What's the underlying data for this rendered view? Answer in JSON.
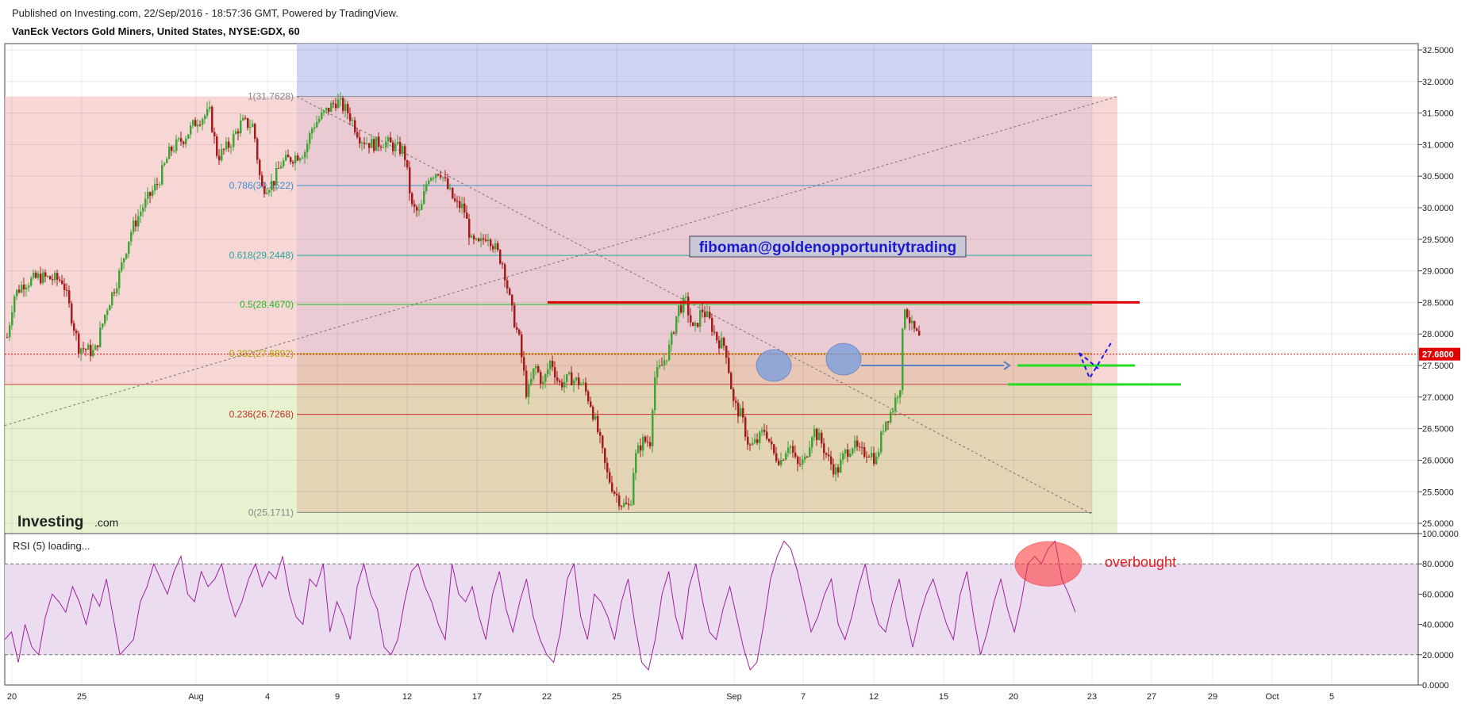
{
  "header": {
    "published": "Published on Investing.com, 22/Sep/2016 - 18:57:36 GMT, Powered by TradingView.",
    "instrument": "VanEck Vectors Gold Miners, United States, NYSE:GDX, 60"
  },
  "colors": {
    "up": "#3fa535",
    "down": "#a51a1a",
    "blue_zone": "#c8cdf2",
    "red_zone": "#f4c8c8",
    "green_zone": "#e2f0c8",
    "resistance": "#dd0000",
    "support": "#22dd22",
    "rsi": "#a020a0",
    "rsi_band": "#ecdcef"
  },
  "chart_data": [
    {
      "type": "candlestick",
      "title": "VanEck Vectors Gold Miners, United States, NYSE:GDX, 60",
      "ylim": [
        24.85,
        32.6
      ],
      "y_ticks": [
        "32.5000",
        "32.0000",
        "31.5000",
        "31.0000",
        "30.5000",
        "30.0000",
        "29.5000",
        "29.0000",
        "28.5000",
        "28.0000",
        "27.5000",
        "27.0000",
        "26.5000",
        "26.0000",
        "25.5000",
        "25.0000"
      ],
      "x_tick_labels": [
        "20",
        "25",
        "Aug",
        "4",
        "9",
        "12",
        "17",
        "22",
        "25",
        "Sep",
        "7",
        "12",
        "15",
        "20",
        "23",
        "27",
        "29",
        "Oct",
        "5"
      ],
      "last_price": "27.6800",
      "fib_levels": [
        {
          "label": "1(31.7628)",
          "value": 31.7628,
          "color": "#888888"
        },
        {
          "label": "0.786(30.3522)",
          "value": 30.3522,
          "color": "#3a8fd0"
        },
        {
          "label": "0.618(29.2448)",
          "value": 29.2448,
          "color": "#22a99a"
        },
        {
          "label": "0.5(28.4670)",
          "value": 28.467,
          "color": "#22bb22"
        },
        {
          "label": "0.382(27.6892)",
          "value": 27.6892,
          "color": "#b0a400"
        },
        {
          "label": "0.236(26.7268)",
          "value": 26.7268,
          "color": "#cc2a2a"
        },
        {
          "label": "0(25.1711)",
          "value": 25.1711,
          "color": "#888888"
        }
      ],
      "annotations": {
        "author_box": "fiboman@goldenopportunitytrading",
        "watermark": "Investing.com"
      },
      "price_path": [
        [
          0,
          27.95
        ],
        [
          8,
          28.6
        ],
        [
          20,
          28.8
        ],
        [
          40,
          28.9
        ],
        [
          70,
          28.85
        ],
        [
          90,
          27.8
        ],
        [
          110,
          27.7
        ],
        [
          125,
          28.4
        ],
        [
          140,
          28.9
        ],
        [
          155,
          29.6
        ],
        [
          170,
          30.0
        ],
        [
          190,
          30.4
        ],
        [
          205,
          30.9
        ],
        [
          222,
          31.1
        ],
        [
          240,
          31.4
        ],
        [
          255,
          31.5
        ],
        [
          265,
          30.8
        ],
        [
          280,
          31.0
        ],
        [
          295,
          31.35
        ],
        [
          310,
          31.3
        ],
        [
          320,
          30.3
        ],
        [
          335,
          30.4
        ],
        [
          345,
          30.7
        ],
        [
          360,
          30.8
        ],
        [
          375,
          30.9
        ],
        [
          385,
          31.3
        ],
        [
          400,
          31.5
        ],
        [
          415,
          31.7
        ],
        [
          430,
          31.5
        ],
        [
          445,
          31.1
        ],
        [
          460,
          31.0
        ],
        [
          475,
          31.05
        ],
        [
          490,
          30.95
        ],
        [
          500,
          30.9
        ],
        [
          510,
          30.0
        ],
        [
          520,
          29.9
        ],
        [
          530,
          30.5
        ],
        [
          545,
          30.6
        ],
        [
          555,
          30.3
        ],
        [
          565,
          30.05
        ],
        [
          575,
          30.0
        ],
        [
          585,
          29.45
        ],
        [
          595,
          29.4
        ],
        [
          605,
          29.6
        ],
        [
          615,
          29.35
        ],
        [
          625,
          29.1
        ],
        [
          635,
          28.4
        ],
        [
          645,
          27.9
        ],
        [
          655,
          27.0
        ],
        [
          665,
          27.5
        ],
        [
          675,
          27.2
        ],
        [
          685,
          27.6
        ],
        [
          695,
          27.2
        ],
        [
          710,
          27.3
        ],
        [
          725,
          27.2
        ],
        [
          735,
          26.9
        ],
        [
          745,
          26.4
        ],
        [
          755,
          25.8
        ],
        [
          765,
          25.5
        ],
        [
          775,
          25.3
        ],
        [
          785,
          25.25
        ],
        [
          790,
          26.0
        ],
        [
          800,
          26.3
        ],
        [
          810,
          26.3
        ],
        [
          815,
          27.3
        ],
        [
          825,
          27.5
        ],
        [
          835,
          27.8
        ],
        [
          845,
          28.4
        ],
        [
          855,
          28.5
        ],
        [
          865,
          28.0
        ],
        [
          875,
          28.4
        ],
        [
          885,
          28.2
        ],
        [
          895,
          27.9
        ],
        [
          905,
          27.8
        ],
        [
          915,
          26.9
        ],
        [
          925,
          26.7
        ],
        [
          935,
          26.2
        ],
        [
          945,
          26.3
        ],
        [
          955,
          26.5
        ],
        [
          965,
          26.1
        ],
        [
          975,
          26.0
        ],
        [
          985,
          26.3
        ],
        [
          995,
          25.9
        ],
        [
          1005,
          26.0
        ],
        [
          1015,
          26.5
        ],
        [
          1025,
          26.3
        ],
        [
          1035,
          26.0
        ],
        [
          1045,
          25.8
        ],
        [
          1055,
          26.1
        ],
        [
          1065,
          26.25
        ],
        [
          1075,
          26.1
        ],
        [
          1085,
          26.15
        ],
        [
          1095,
          26.0
        ],
        [
          1105,
          26.6
        ],
        [
          1115,
          26.8
        ],
        [
          1125,
          27.2
        ],
        [
          1130,
          28.5
        ],
        [
          1140,
          28.1
        ],
        [
          1150,
          27.9
        ]
      ],
      "overlays": {
        "resistance": 28.5,
        "support_upper": 27.5,
        "support_lower": 27.2
      }
    },
    {
      "type": "line",
      "title": "RSI (5) loading...",
      "series_name": "RSI (5)",
      "ylim": [
        0,
        100
      ],
      "y_ticks": [
        "100.0000",
        "80.0000",
        "60.0000",
        "40.0000",
        "20.0000",
        "0.0000"
      ],
      "band": [
        20,
        80
      ],
      "annotation": "overbought",
      "values": [
        30,
        35,
        15,
        40,
        25,
        20,
        45,
        60,
        55,
        48,
        65,
        55,
        40,
        60,
        52,
        70,
        45,
        20,
        25,
        30,
        55,
        65,
        80,
        70,
        60,
        75,
        85,
        60,
        55,
        75,
        65,
        70,
        80,
        60,
        45,
        55,
        70,
        80,
        65,
        75,
        70,
        85,
        60,
        45,
        40,
        70,
        65,
        80,
        35,
        55,
        45,
        30,
        65,
        80,
        60,
        50,
        25,
        20,
        30,
        55,
        75,
        80,
        65,
        55,
        40,
        30,
        80,
        60,
        55,
        65,
        45,
        30,
        60,
        75,
        50,
        35,
        55,
        70,
        45,
        30,
        20,
        15,
        35,
        70,
        80,
        45,
        30,
        60,
        55,
        45,
        30,
        55,
        70,
        40,
        15,
        10,
        30,
        60,
        75,
        45,
        30,
        65,
        80,
        55,
        35,
        30,
        50,
        65,
        45,
        25,
        10,
        15,
        40,
        70,
        85,
        95,
        90,
        75,
        55,
        35,
        45,
        60,
        70,
        40,
        30,
        45,
        65,
        80,
        55,
        40,
        35,
        55,
        70,
        45,
        25,
        45,
        60,
        70,
        55,
        40,
        30,
        60,
        75,
        45,
        20,
        35,
        55,
        70,
        50,
        35,
        55,
        80,
        85,
        80,
        90,
        95,
        70,
        60,
        48
      ]
    }
  ]
}
